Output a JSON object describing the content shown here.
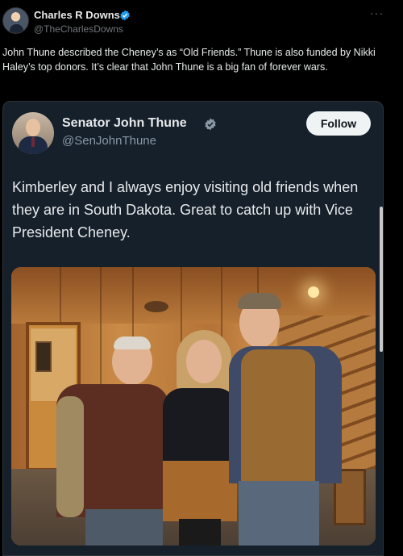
{
  "post": {
    "author_name": "Charles R Downs",
    "author_handle": "@TheCharlesDowns",
    "more_label": "···",
    "text": "John Thune described the Cheney’s as “Old Friends.” Thune is also funded by Nikki Haley’s top donors. It’s clear that John Thune is a big fan of forever wars."
  },
  "quoted": {
    "author_name": "Senator John Thune",
    "author_handle": "@SenJohnThune",
    "follow_label": "Follow",
    "text": "Kimberley and I always enjoy visiting old friends when they are in South Dakota. Great to catch up with Vice President Cheney."
  },
  "colors": {
    "background": "#000000",
    "card": "#15202b",
    "verified": "#1d9bf0",
    "muted_text": "#71767b"
  },
  "icons": {
    "verified": "verified-badge-icon",
    "more": "more-icon"
  }
}
